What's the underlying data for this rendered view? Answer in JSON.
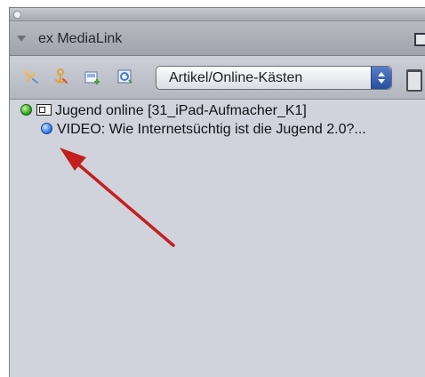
{
  "panel": {
    "title": "ex MediaLink"
  },
  "toolbar": {
    "tools": [
      {
        "icon": "link-tool-icon"
      },
      {
        "icon": "anchor-tool-icon"
      },
      {
        "icon": "add-frame-icon"
      },
      {
        "icon": "refresh-frame-icon"
      }
    ],
    "select": {
      "value": "Artikel/Online-Kästen"
    },
    "trash_icon": "trash-icon"
  },
  "tree": {
    "items": [
      {
        "label": "Jugend online [31_iPad-Aufmacher_K1]",
        "status_color": "#33a81f"
      },
      {
        "label": "VIDEO: Wie Internetsüchtig ist die Jugend 2.0?...",
        "status_color": "#3a7ee6"
      }
    ]
  },
  "annotation": {
    "arrow_color": "#c41f1f"
  }
}
